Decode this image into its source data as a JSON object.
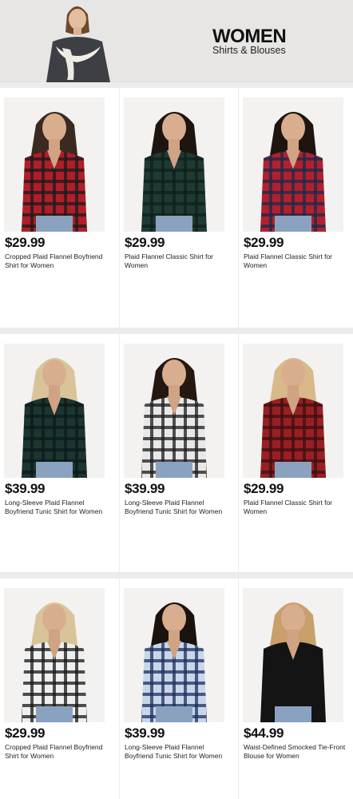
{
  "header": {
    "title": "WOMEN",
    "subtitle": "Shirts & Blouses"
  },
  "products": [
    {
      "price": "$29.99",
      "name": "Cropped Plaid Flannel Boyfriend Shirt for Women",
      "shirt_color": "#b01e2a",
      "stripe_color": "#1a1a1a",
      "hair_color": "#3a2a1f"
    },
    {
      "price": "$29.99",
      "name": "Plaid Flannel Classic Shirt for Women",
      "shirt_color": "#1f3a33",
      "stripe_color": "#0f1f1a",
      "hair_color": "#1e1510"
    },
    {
      "price": "$29.99",
      "name": "Plaid Flannel Classic Shirt for Women",
      "shirt_color": "#b3202d",
      "stripe_color": "#1a2a4a",
      "hair_color": "#1e1510"
    },
    {
      "price": "$39.99",
      "name": "Long-Sleeve Plaid Flannel Boyfriend Tunic Shirt for Women",
      "shirt_color": "#1d3531",
      "stripe_color": "#0c1a1a",
      "hair_color": "#d9c49a"
    },
    {
      "price": "$39.99",
      "name": "Long-Sleeve Plaid Flannel Boyfriend Tunic Shirt for Women",
      "shirt_color": "#e8e8e8",
      "stripe_color": "#1a1a1a",
      "hair_color": "#241810"
    },
    {
      "price": "$29.99",
      "name": "Plaid Flannel Classic Shirt for Women",
      "shirt_color": "#9a1f25",
      "stripe_color": "#3a1010",
      "hair_color": "#d8b98a"
    },
    {
      "price": "$29.99",
      "name": "Cropped Plaid Flannel Boyfriend Shirt for Women",
      "shirt_color": "#efefef",
      "stripe_color": "#151515",
      "hair_color": "#d9c49a"
    },
    {
      "price": "$39.99",
      "name": "Long-Sleeve Plaid Flannel Boyfriend Tunic Shirt for Women",
      "shirt_color": "#c9d6ea",
      "stripe_color": "#1c2f5c",
      "hair_color": "#1a120c"
    },
    {
      "price": "$44.99",
      "name": "Waist-Defined Smocked Tie-Front Blouse for Women",
      "shirt_color": "#141414",
      "stripe_color": "#141414",
      "hair_color": "#c9a06a"
    }
  ]
}
